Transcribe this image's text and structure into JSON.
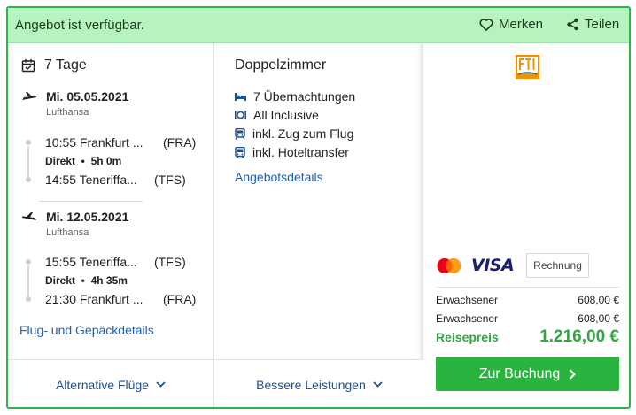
{
  "header": {
    "availability": "Angebot ist verfügbar.",
    "save_label": "Merken",
    "share_label": "Teilen"
  },
  "trip": {
    "duration": "7 Tage",
    "outbound": {
      "date": "Mi. 05.05.2021",
      "airline": "Lufthansa",
      "dep_time_place": "10:55 Frankfurt ...",
      "dep_code": "(FRA)",
      "direct_label": "Direkt",
      "duration": "5h 0m",
      "arr_time_place": "14:55 Teneriffa...",
      "arr_code": "(TFS)"
    },
    "return": {
      "date": "Mi. 12.05.2021",
      "airline": "Lufthansa",
      "dep_time_place": "15:55 Teneriffa...",
      "dep_code": "(TFS)",
      "direct_label": "Direkt",
      "duration": "4h 35m",
      "arr_time_place": "21:30 Frankfurt ...",
      "arr_code": "(FRA)"
    },
    "details_link": "Flug- und Gepäckdetails"
  },
  "room": {
    "title": "Doppelzimmer",
    "features": [
      "7 Übernachtungen",
      "All Inclusive",
      "inkl. Zug zum Flug",
      "inkl. Hoteltransfer"
    ],
    "details_link": "Angebotsdetails"
  },
  "pricing": {
    "logo_text": "FTI",
    "visa": "VISA",
    "invoice": "Rechnung",
    "lines": [
      {
        "label": "Erwachsener",
        "price": "608,00 €"
      },
      {
        "label": "Erwachsener",
        "price": "608,00 €"
      }
    ],
    "total_label": "Reisepreis",
    "total_price": "1.216,00 €",
    "book_label": "Zur Buchung"
  },
  "footer": {
    "alt_flights": "Alternative Flüge",
    "better_services": "Bessere Leistungen"
  },
  "colors": {
    "accent_green": "#28b43f",
    "header_bg": "#b6f3be",
    "link_blue": "#1d5fb3"
  }
}
